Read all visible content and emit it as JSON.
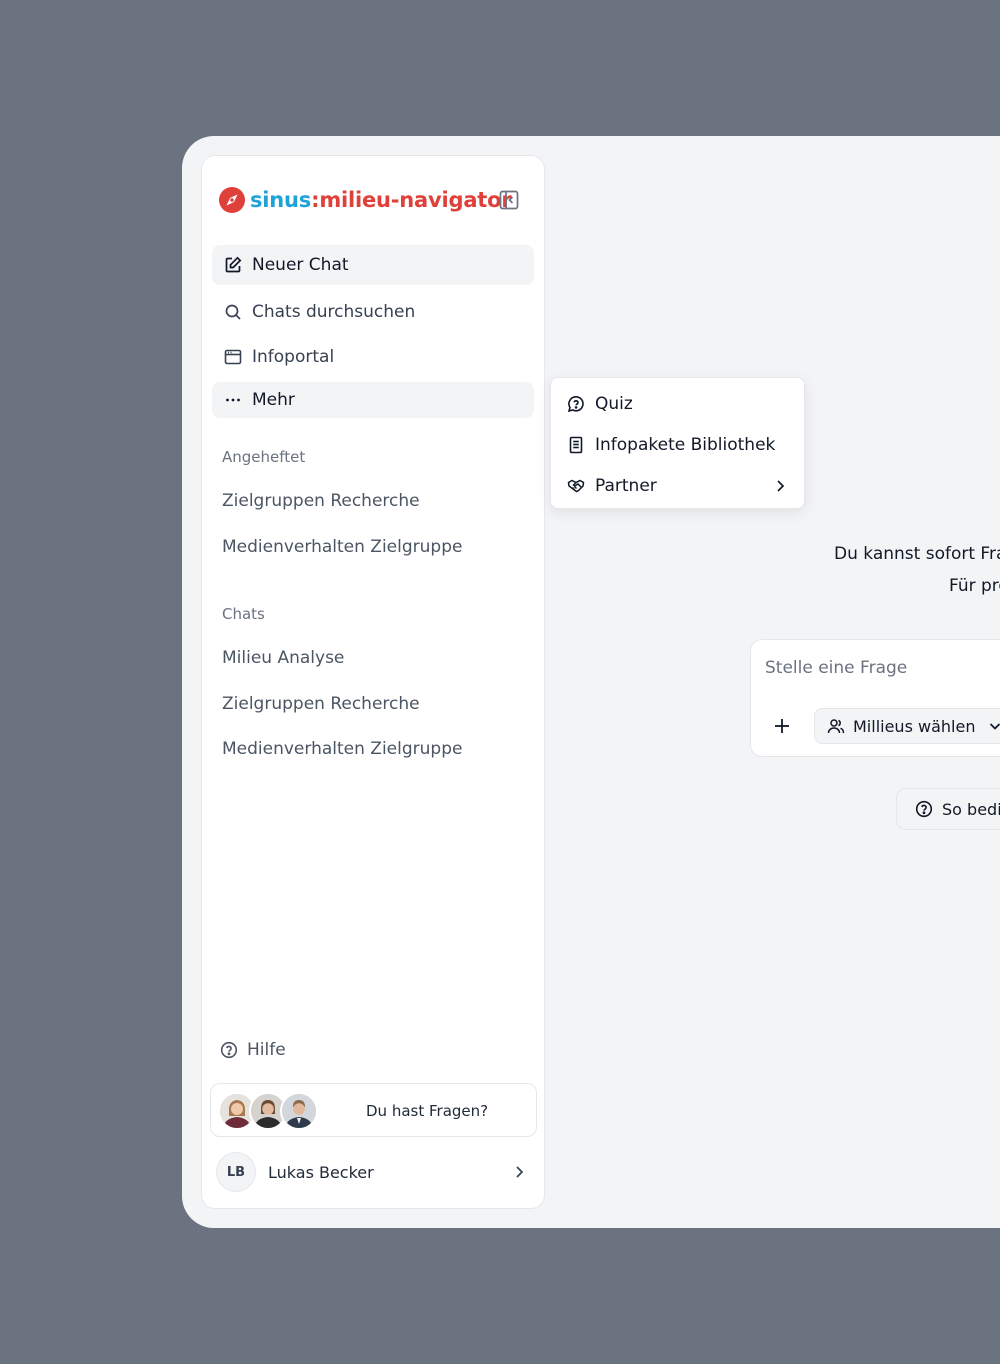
{
  "brand": {
    "logo_sinus": "sinus",
    "logo_separator": ":",
    "logo_rest": "milieu-navigator",
    "colors": {
      "blue": "#1ea2d8",
      "red": "#e0403a"
    }
  },
  "sidebar": {
    "nav": [
      {
        "label": "Neuer Chat",
        "icon": "edit-icon",
        "active": true
      },
      {
        "label": "Chats durchsuchen",
        "icon": "search-icon",
        "active": false
      },
      {
        "label": "Infoportal",
        "icon": "browser-window-icon",
        "active": false
      },
      {
        "label": "Mehr",
        "icon": "more-horizontal-icon",
        "active": true
      }
    ],
    "pinned_label": "Angeheftet",
    "pinned": [
      "Zielgruppen Recherche",
      "Medienverhalten Zielgruppe"
    ],
    "chats_label": "Chats",
    "chats": [
      "Milieu Analyse",
      "Zielgruppen Recherche",
      "Medienverhalten Zielgruppe"
    ],
    "help_label": "Hilfe",
    "contact_label": "Du hast Fragen?",
    "user": {
      "initials": "LB",
      "name": "Lukas Becker"
    }
  },
  "more_menu": {
    "items": [
      {
        "label": "Quiz",
        "icon": "chat-question-icon"
      },
      {
        "label": "Infopakete Bibliothek",
        "icon": "document-icon"
      },
      {
        "label": "Partner",
        "icon": "handshake-icon",
        "has_submenu": true
      }
    ]
  },
  "main": {
    "intro_line1": "Du kannst sofort Frag",
    "intro_line2": "Für prö",
    "composer": {
      "placeholder": "Stelle eine Frage",
      "value": "",
      "milieus_button": "Millieus wählen"
    },
    "howto_button": "So bedie"
  }
}
